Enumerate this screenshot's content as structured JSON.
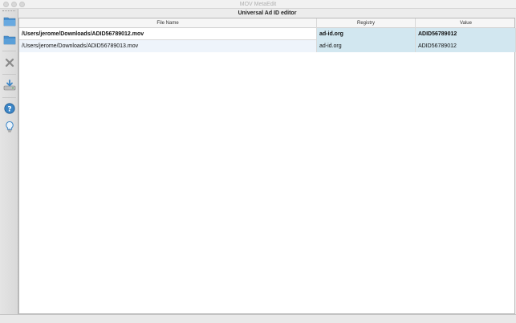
{
  "window": {
    "title": "MOV MetaEdit"
  },
  "editor": {
    "title": "Universal Ad ID editor"
  },
  "toolbar": {
    "tools": [
      {
        "icon": "folder-open-icon"
      },
      {
        "icon": "folder-icon"
      },
      {
        "icon": "close-icon"
      },
      {
        "icon": "save-drive-icon"
      },
      {
        "icon": "help-icon"
      },
      {
        "icon": "lightbulb-icon"
      }
    ]
  },
  "table": {
    "headers": {
      "file": "File Name",
      "registry": "Registry",
      "value": "Value"
    },
    "rows": [
      {
        "file": "/Users/jerome/Downloads/ADID56789012.mov",
        "registry": "ad-id.org",
        "value": "ADID56789012",
        "bold": true
      },
      {
        "file": "/Users/jerome/Downloads/ADID56789013.mov",
        "registry": "ad-id.org",
        "value": "ADID56789012",
        "bold": false
      }
    ]
  },
  "colors": {
    "registry_value_bg": "#d2e7f0",
    "row_alt_bg": "#eef4fb",
    "icon_blue": "#3d86c6"
  }
}
